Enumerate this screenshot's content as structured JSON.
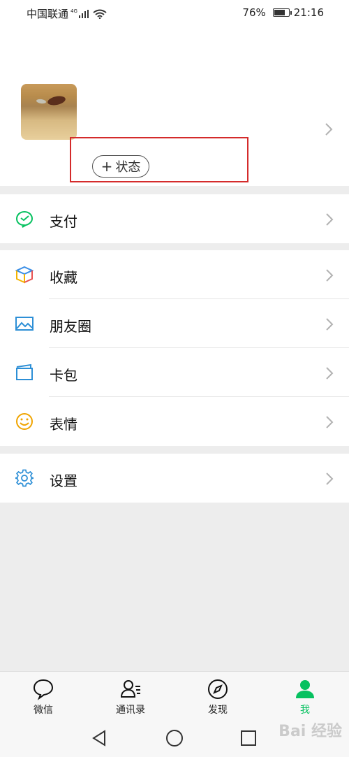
{
  "status_bar": {
    "carrier": "中国联通",
    "network": "4G",
    "battery_percent": "76%",
    "battery_level": 0.76,
    "time": "21:16"
  },
  "profile": {
    "status_button_label": "状态",
    "status_button_prefix": "+"
  },
  "menu": {
    "pay": {
      "label": "支付",
      "icon": "pay-icon"
    },
    "favorites": {
      "label": "收藏",
      "icon": "favorites-cube-icon"
    },
    "moments": {
      "label": "朋友圈",
      "icon": "moments-image-icon"
    },
    "cards": {
      "label": "卡包",
      "icon": "card-wallet-icon"
    },
    "stickers": {
      "label": "表情",
      "icon": "smiley-icon"
    },
    "settings": {
      "label": "设置",
      "icon": "gear-icon"
    }
  },
  "tabs": [
    {
      "label": "微信",
      "icon": "chat-bubble-icon"
    },
    {
      "label": "通讯录",
      "icon": "contacts-icon"
    },
    {
      "label": "发现",
      "icon": "compass-icon"
    },
    {
      "label": "我",
      "icon": "person-icon",
      "active": true
    }
  ],
  "watermark": "Bai 经验",
  "colors": {
    "accent": "#07c160",
    "highlight": "#d42b2b",
    "background": "#ededed"
  }
}
